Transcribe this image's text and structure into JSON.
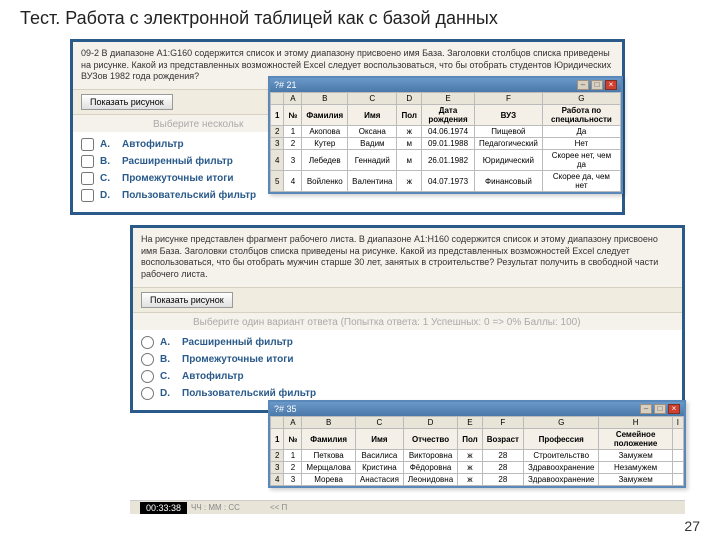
{
  "title": "Тест. Работа с электронной таблицей как с базой данных",
  "page_number": "27",
  "q1": {
    "text": "09-2 В диапазоне A1:G160 содержится список и этому диапазону присвоено имя База. Заголовки столбцов списка приведены на рисунке. Какой из представленных возможностей Excel следует воспользоваться, что бы отобрать студентов Юридических ВУЗов 1982 года рождения?",
    "show_btn": "Показать рисунок",
    "choose": "Выберите нескольк",
    "options": [
      {
        "letter": "A.",
        "text": "Автофильтр"
      },
      {
        "letter": "B.",
        "text": "Расширенный фильтр"
      },
      {
        "letter": "C.",
        "text": "Промежуточные итоги"
      },
      {
        "letter": "D.",
        "text": "Пользовательский фильтр"
      }
    ],
    "popup_title": "?# 21",
    "sheet": {
      "cols": [
        "",
        "A",
        "B",
        "C",
        "D",
        "E",
        "F",
        "G"
      ],
      "header": [
        "1",
        "№",
        "Фамилия",
        "Имя",
        "Пол",
        "Дата рождения",
        "ВУЗ",
        "Работа по специальности"
      ],
      "rows": [
        [
          "2",
          "1",
          "Акопова",
          "Оксана",
          "ж",
          "04.06.1974",
          "Пищевой",
          "Да"
        ],
        [
          "3",
          "2",
          "Кутер",
          "Вадим",
          "м",
          "09.01.1988",
          "Педагогический",
          "Нет"
        ],
        [
          "4",
          "3",
          "Лебедев",
          "Геннадий",
          "м",
          "26.01.1982",
          "Юридический",
          "Скорее нет, чем да"
        ],
        [
          "5",
          "4",
          "Войленко",
          "Валентина",
          "ж",
          "04.07.1973",
          "Финансовый",
          "Скорее да, чем нет"
        ]
      ]
    }
  },
  "q2": {
    "text": "На рисунке представлен фрагмент рабочего листа. В диапазоне A1:H160 содержится список и этому диапазону присвоено имя База. Заголовки столбцов списка приведены на рисунке. Какой из представленных возможностей Excel следует воспользоваться, что бы отобрать мужчин старше 30 лет, занятых в строительстве? Результат получить в свободной части рабочего листа.",
    "show_btn": "Показать рисунок",
    "choose": "Выберите один вариант ответа (Попытка ответа: 1  Успешных: 0 => 0%  Баллы: 100)",
    "options": [
      {
        "letter": "A.",
        "text": "Расширенный фильтр"
      },
      {
        "letter": "B.",
        "text": "Промежуточные итоги"
      },
      {
        "letter": "C.",
        "text": "Автофильтр"
      },
      {
        "letter": "D.",
        "text": "Пользовательский фильтр"
      }
    ],
    "popup_title": "?# 35",
    "sheet": {
      "cols": [
        "",
        "A",
        "B",
        "C",
        "D",
        "E",
        "F",
        "G",
        "H",
        "I"
      ],
      "header": [
        "1",
        "№",
        "Фамилия",
        "Имя",
        "Отчество",
        "Пол",
        "Возраст",
        "Профессия",
        "Семейное положение",
        ""
      ],
      "rows": [
        [
          "2",
          "1",
          "Петкова",
          "Василиса",
          "Викторовна",
          "ж",
          "28",
          "Строительство",
          "Замужем",
          ""
        ],
        [
          "3",
          "2",
          "Мерщалова",
          "Кристина",
          "Фёдоровна",
          "ж",
          "28",
          "Здравоохранение",
          "Незамужем",
          ""
        ],
        [
          "4",
          "3",
          "Морева",
          "Анастасия",
          "Леонидовна",
          "ж",
          "28",
          "Здравоохранение",
          "Замужем",
          ""
        ]
      ]
    }
  },
  "timer": {
    "value": "00:33:38",
    "label": "ЧЧ : ММ : СС",
    "prev": "<< П"
  }
}
